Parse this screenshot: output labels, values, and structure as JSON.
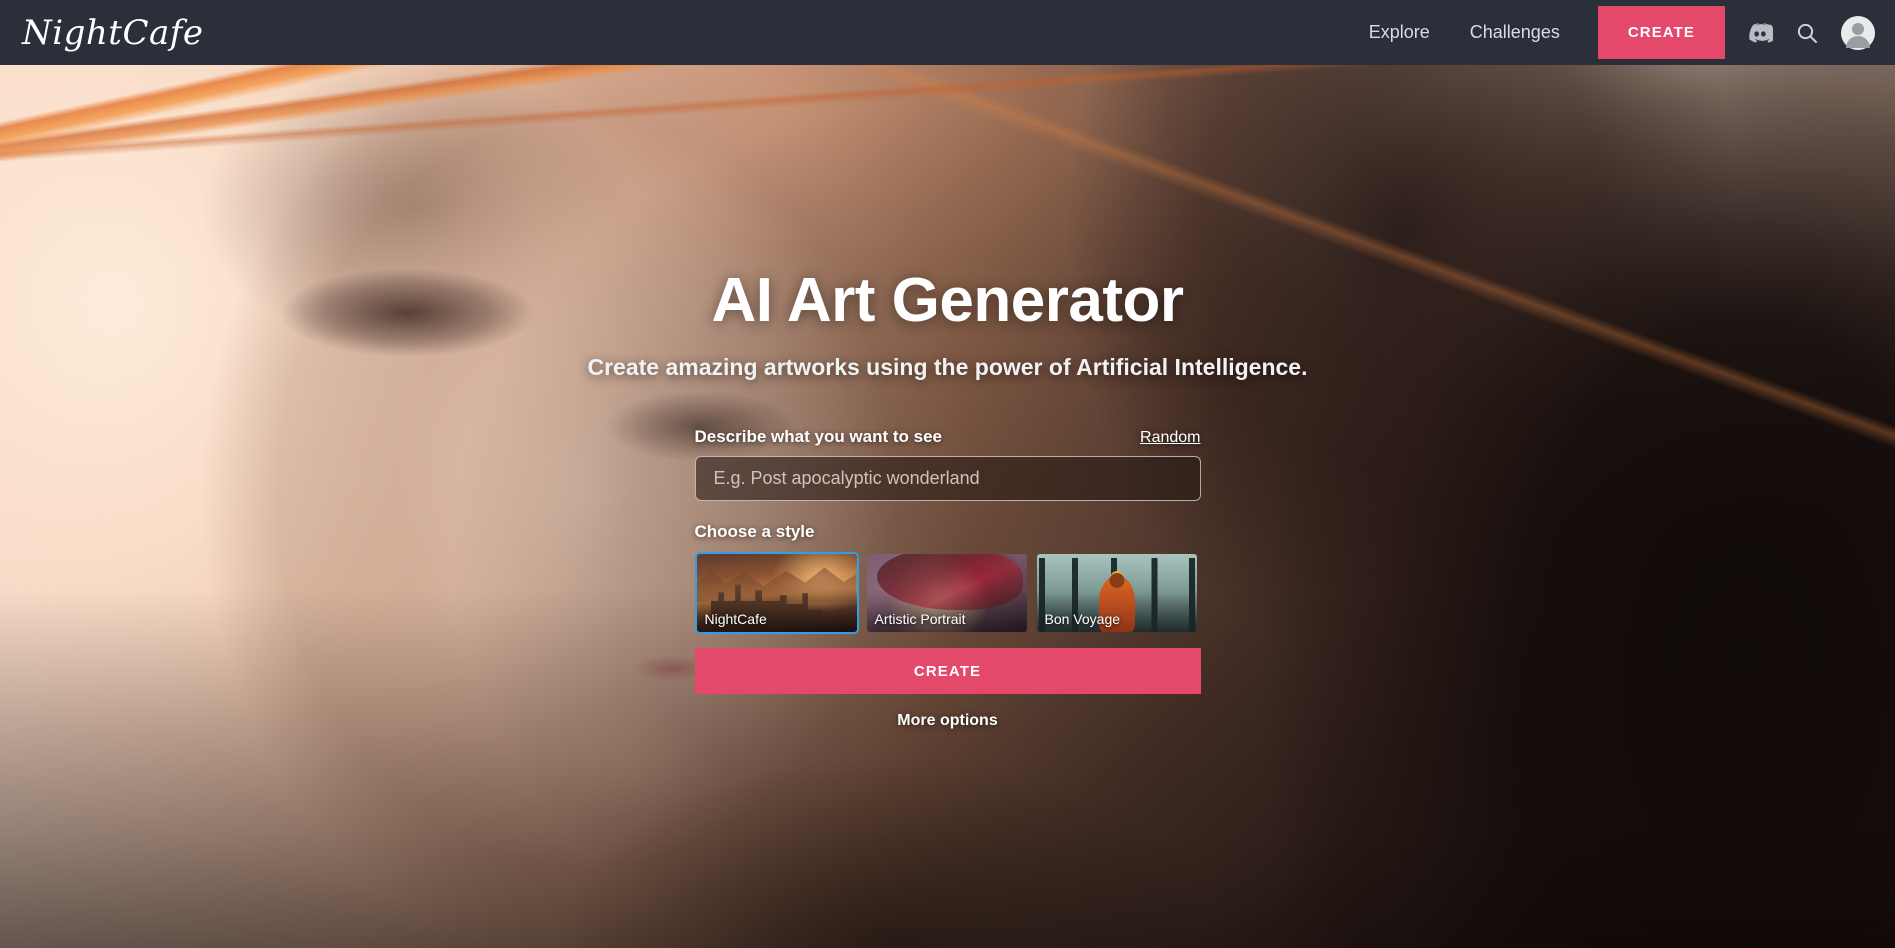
{
  "header": {
    "brand": "NightCafe",
    "nav_links": [
      {
        "label": "Explore",
        "name": "explore"
      },
      {
        "label": "Challenges",
        "name": "challenges"
      }
    ],
    "create_label": "CREATE",
    "icons": {
      "discord": "discord-icon",
      "search": "search-icon",
      "avatar": "avatar"
    },
    "colors": {
      "background": "#2b2f3a",
      "accent_pink": "#e4496c",
      "nav_text": "#d8dce4"
    }
  },
  "hero": {
    "title": "AI Art Generator",
    "subtitle": "Create amazing artworks using the power of Artificial Intelligence."
  },
  "form": {
    "prompt_label": "Describe what you want to see",
    "random_label": "Random",
    "prompt_value": "",
    "prompt_placeholder": "E.g. Post apocalyptic wonderland",
    "style_label": "Choose a style",
    "styles": [
      {
        "name": "NightCafe",
        "selected": true
      },
      {
        "name": "Artistic Portrait",
        "selected": false
      },
      {
        "name": "Bon Voyage",
        "selected": false
      }
    ],
    "create_label": "CREATE",
    "more_options_label": "More options",
    "colors": {
      "selected_border": "#2e9fe8",
      "create_button": "#e4496c"
    }
  }
}
